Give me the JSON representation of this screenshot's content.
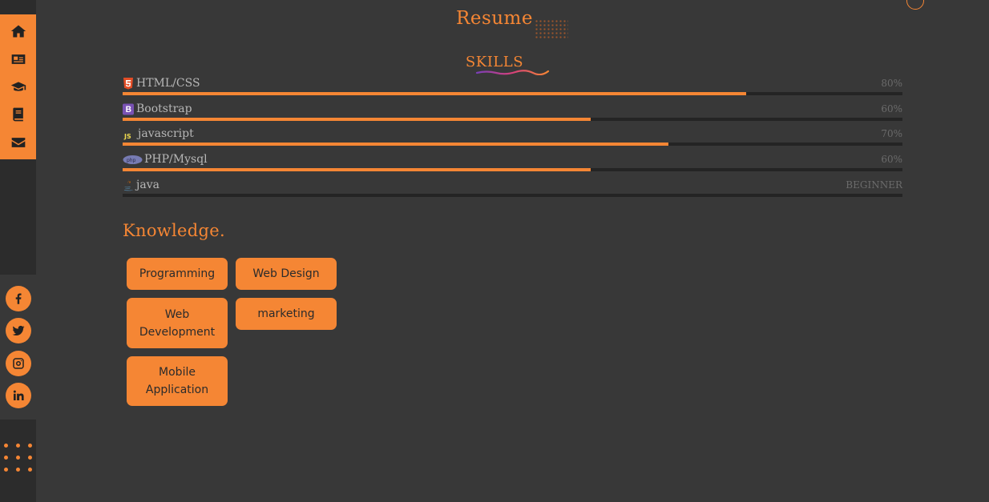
{
  "header": {
    "title": "Resume",
    "skills_heading": "SKILLS"
  },
  "skills": [
    {
      "icon": "html5-icon",
      "label": "HTML/CSS",
      "value": "80%",
      "level": 0.8
    },
    {
      "icon": "bootstrap-icon",
      "label": "Bootstrap",
      "value": "60%",
      "level": 0.6
    },
    {
      "icon": "js-icon",
      "label": "javascript",
      "value": "70%",
      "level": 0.7
    },
    {
      "icon": "php-icon",
      "label": "PHP/Mysql",
      "value": "60%",
      "level": 0.6
    },
    {
      "icon": "java-icon",
      "label": "java",
      "value": "BEGINNER",
      "level": 0
    }
  ],
  "knowledge": {
    "heading": "Knowledge.",
    "tags": [
      "Programming",
      "Web Design",
      "Web Development",
      "marketing",
      "Mobile Application"
    ]
  },
  "sidebar": {
    "nav": [
      "home-icon",
      "id-card-icon",
      "graduation-cap-icon",
      "book-icon",
      "envelope-icon"
    ],
    "social": [
      "facebook-icon",
      "twitter-icon",
      "instagram-icon",
      "linkedin-icon"
    ]
  },
  "colors": {
    "accent": "#f58634",
    "background": "#383838",
    "sidebar": "#2c2c2c",
    "track": "#242424"
  }
}
